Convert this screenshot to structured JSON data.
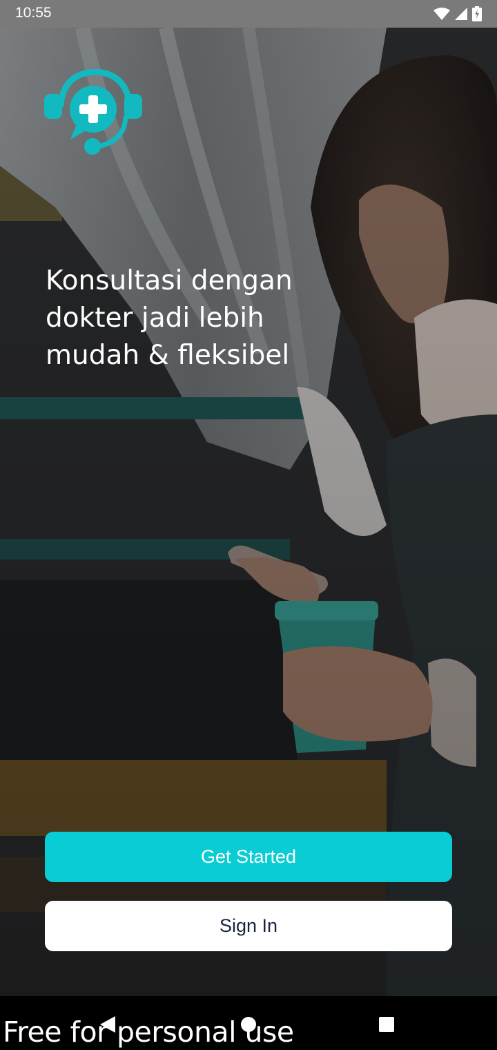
{
  "status_bar": {
    "time": "10:55",
    "icons": [
      "wifi-icon",
      "cell-signal-icon",
      "battery-icon"
    ]
  },
  "brand": {
    "logo_icon": "medical-headset-chat-icon",
    "accent_color": "#0accd4"
  },
  "onboarding": {
    "headline_lines": [
      "Konsultasi dengan",
      "dokter jadi lebih",
      "mudah & fleksibel"
    ]
  },
  "actions": {
    "get_started_label": "Get Started",
    "sign_in_label": "Sign In"
  },
  "nav_bar": {
    "buttons": [
      "back-icon",
      "home-icon",
      "recents-icon"
    ]
  },
  "watermark": {
    "text": "Free for personal use"
  }
}
